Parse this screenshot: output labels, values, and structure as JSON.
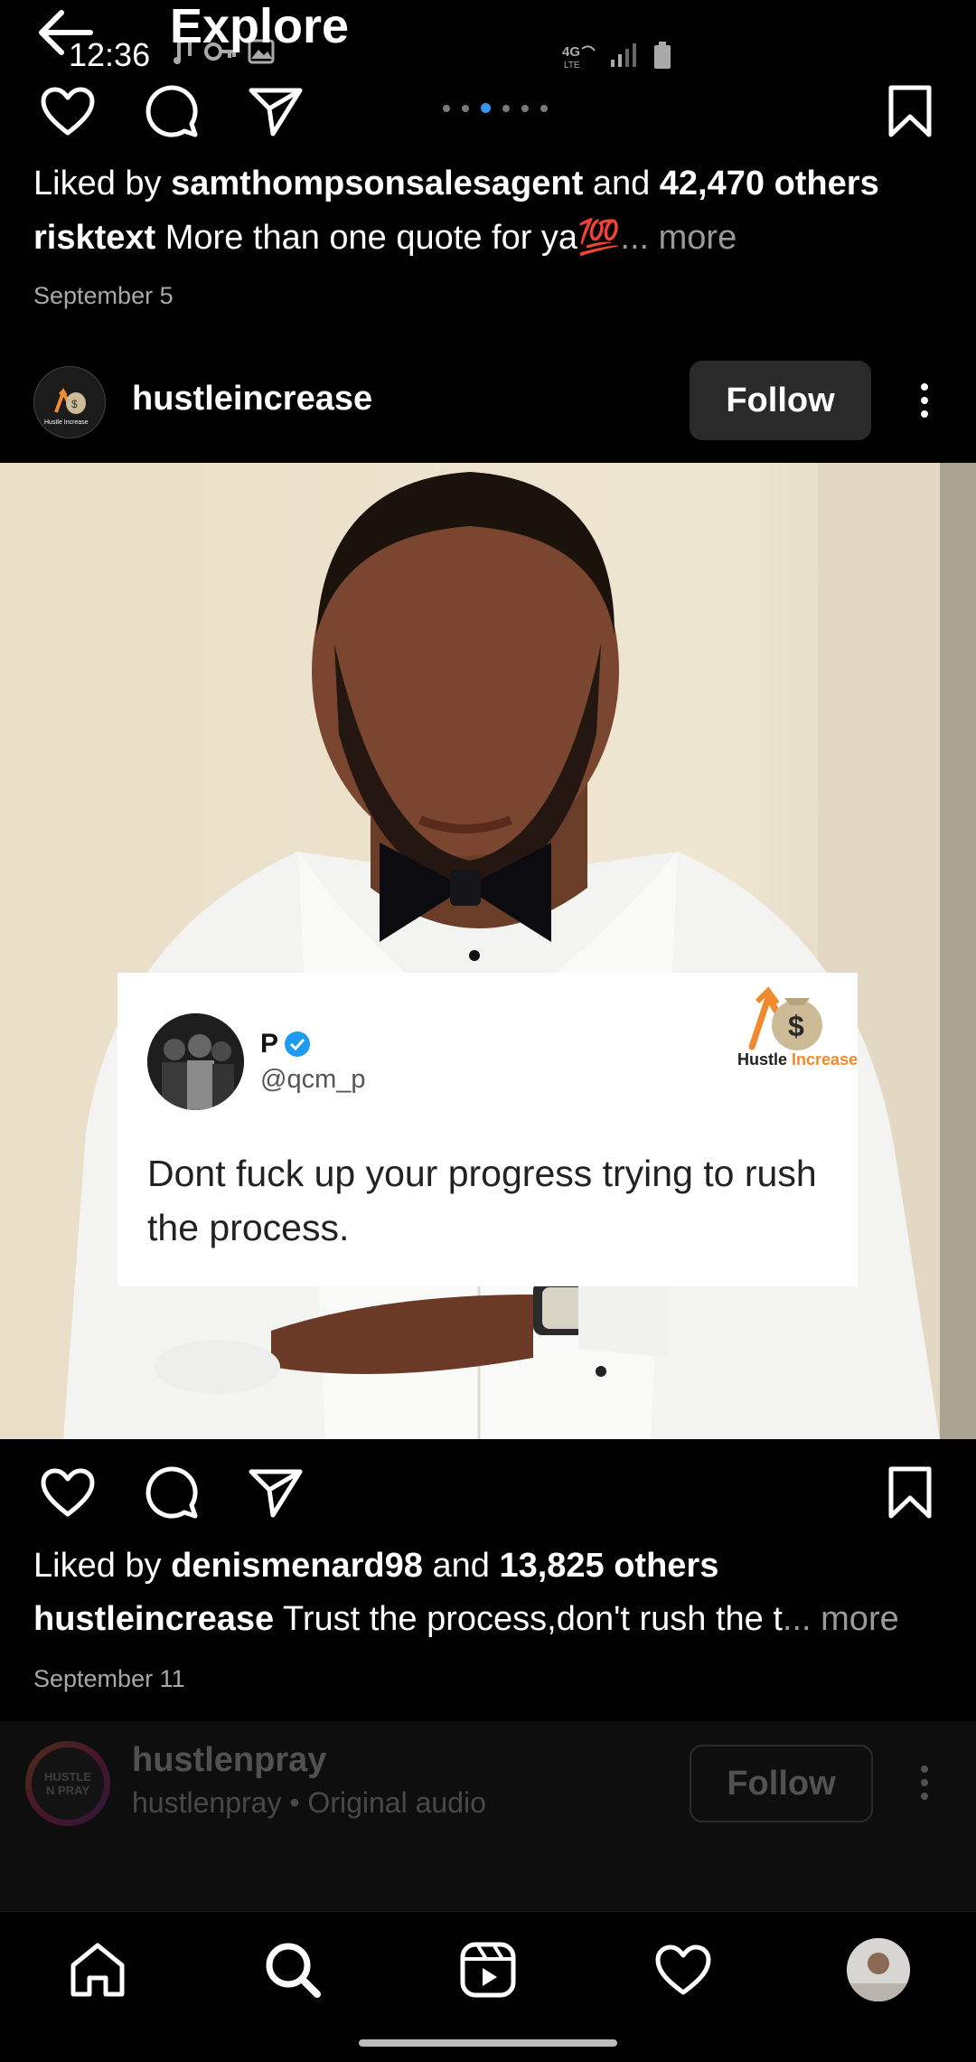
{
  "status_bar": {
    "time": "12:36",
    "network": "4G LTE"
  },
  "header": {
    "title": "Explore"
  },
  "post1": {
    "likes_prefix": "Liked by",
    "liked_by_user": "samthompsonsalesagent",
    "likes_and": "and",
    "likes_others": "42,470 others",
    "caption_user": "risktext",
    "caption_text": "More than one quote for ya💯",
    "caption_more": "... more",
    "date": "September 5",
    "carousel_count": 6,
    "carousel_active": 2
  },
  "post2": {
    "username": "hustleincrease",
    "follow_label": "Follow",
    "quote": {
      "name": "P",
      "handle": "@qcm_p",
      "text": "Dont fuck up your progress trying to rush the process.",
      "brand_part1": "Hustle",
      "brand_part2": "Increase"
    },
    "likes_prefix": "Liked by",
    "liked_by_user": "denismenard98",
    "likes_and": "and",
    "likes_others": "13,825 others",
    "caption_user": "hustleincrease",
    "caption_text": "Trust the process,don't rush the t",
    "caption_more": "... more",
    "date": "September 11"
  },
  "post3": {
    "username": "hustlenpray",
    "subtitle": "hustlenpray • Original audio",
    "follow_label": "Follow",
    "avatar_text_line1": "HUSTLE",
    "avatar_text_line2": "N PRAY"
  },
  "colors": {
    "accent": "#3797f0",
    "brand_orange": "#f08a2c"
  },
  "icons": [
    "back-arrow-icon",
    "heart-icon",
    "comment-icon",
    "share-icon",
    "bookmark-icon",
    "more-icon",
    "home-icon",
    "search-icon",
    "reels-icon",
    "activity-icon",
    "profile-avatar"
  ]
}
